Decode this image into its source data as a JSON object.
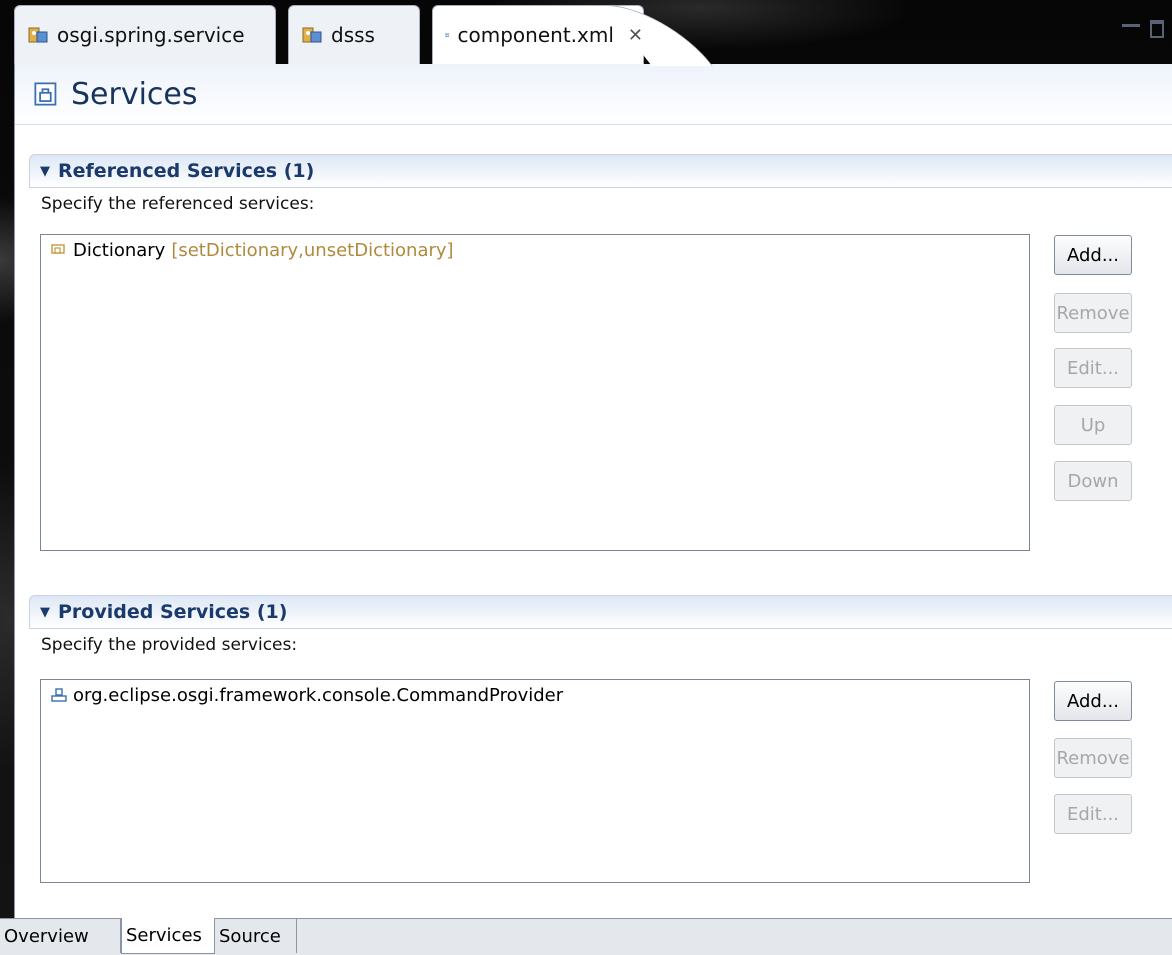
{
  "tabs": [
    {
      "label": "osgi.spring.service",
      "icon": "plugin-icon",
      "active": false
    },
    {
      "label": "dsss",
      "icon": "plugin-icon",
      "active": false
    },
    {
      "label": "component.xml",
      "icon": "component-file-icon",
      "active": true,
      "close": "✕"
    }
  ],
  "header": {
    "title": "Services",
    "icon": "component-file-icon"
  },
  "referenced": {
    "title": "Referenced Services (1)",
    "description": "Specify the referenced services:",
    "items": [
      {
        "name": "Dictionary",
        "decoration": "[setDictionary,unsetDictionary]",
        "icon": "reference-icon"
      }
    ],
    "buttons": {
      "add": "Add...",
      "remove": "Remove",
      "edit": "Edit...",
      "up": "Up",
      "down": "Down"
    }
  },
  "provided": {
    "title": "Provided Services (1)",
    "description": "Specify the provided services:",
    "items": [
      {
        "name": "org.eclipse.osgi.framework.console.CommandProvider",
        "icon": "provide-icon"
      }
    ],
    "buttons": {
      "add": "Add...",
      "remove": "Remove",
      "edit": "Edit..."
    }
  },
  "bottom_tabs": [
    {
      "label": "Overview",
      "active": false
    },
    {
      "label": "Services",
      "active": true
    },
    {
      "label": "Source",
      "active": false
    }
  ],
  "colors": {
    "section_title": "#1a3a6b",
    "decoration": "#b08a3c",
    "disabled_text": "#a7a7a7"
  }
}
